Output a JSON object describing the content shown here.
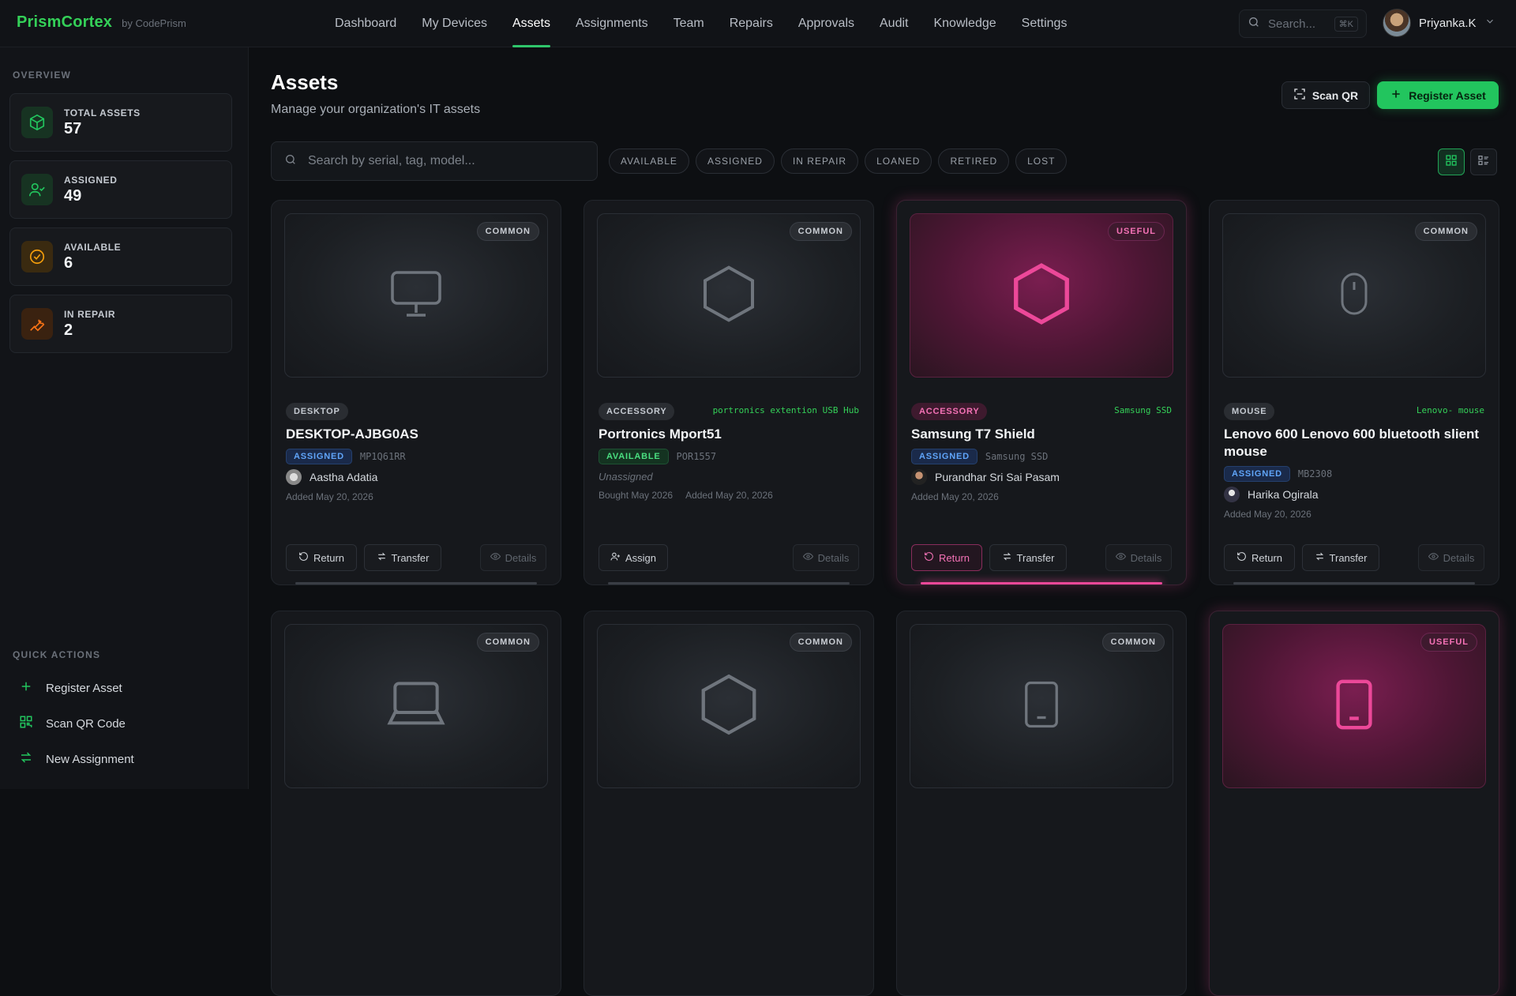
{
  "brand": {
    "name": "PrismCortex",
    "sub": "by CodePrism"
  },
  "nav": [
    "Dashboard",
    "My Devices",
    "Assets",
    "Assignments",
    "Team",
    "Repairs",
    "Approvals",
    "Audit",
    "Knowledge",
    "Settings"
  ],
  "nav_active": "Assets",
  "top_search": {
    "placeholder": "Search...",
    "shortcut": "⌘K"
  },
  "user": {
    "name": "Priyanka.K"
  },
  "sidebar": {
    "overview_label": "OVERVIEW",
    "stats": [
      {
        "label": "TOTAL ASSETS",
        "value": "57",
        "icon": "cube-icon",
        "color": "#22c55e"
      },
      {
        "label": "ASSIGNED",
        "value": "49",
        "icon": "user-check-icon",
        "color": "#22c55e"
      },
      {
        "label": "AVAILABLE",
        "value": "6",
        "icon": "check-circle-icon",
        "color": "#f59e0b"
      },
      {
        "label": "IN REPAIR",
        "value": "2",
        "icon": "wrench-icon",
        "color": "#f97316"
      }
    ],
    "quick_label": "QUICK ACTIONS",
    "quick": [
      {
        "label": "Register Asset",
        "icon": "plus-icon"
      },
      {
        "label": "Scan QR Code",
        "icon": "qr-icon"
      },
      {
        "label": "New Assignment",
        "icon": "swap-icon"
      }
    ]
  },
  "page": {
    "title": "Assets",
    "subtitle": "Manage your organization's IT assets"
  },
  "buttons": {
    "scan": "Scan QR",
    "register": "Register Asset"
  },
  "search": {
    "placeholder": "Search by serial, tag, model..."
  },
  "filters": [
    "AVAILABLE",
    "ASSIGNED",
    "IN REPAIR",
    "LOANED",
    "RETIRED",
    "LOST"
  ],
  "colors": {
    "accent": "#22c55e",
    "pink": "#ec4899",
    "assigned": "#60a5fa"
  },
  "cards": [
    {
      "rarity": "COMMON",
      "category": "DESKTOP",
      "model_note": "",
      "name": "DESKTOP-AJBG0AS",
      "status": "ASSIGNED",
      "serial": "MP1Q61RR",
      "owner": "Aastha Adatia",
      "added": "Added May 20, 2026",
      "actions": [
        "Return",
        "Transfer",
        "Details"
      ],
      "icon": "monitor-icon"
    },
    {
      "rarity": "COMMON",
      "category": "ACCESSORY",
      "model_note": "portronics extention USB Hub",
      "name": "Portronics Mport51",
      "status": "AVAILABLE",
      "serial": "POR1557",
      "owner": "Unassigned",
      "bought": "Bought May 2026",
      "added": "Added May 20, 2026",
      "actions": [
        "Assign",
        "Details"
      ],
      "icon": "hexagon-icon"
    },
    {
      "rarity": "USEFUL",
      "category": "ACCESSORY",
      "model_note": "Samsung SSD",
      "name": "Samsung T7 Shield",
      "status": "ASSIGNED",
      "serial": "Samsung SSD",
      "owner": "Purandhar Sri Sai Pasam",
      "added": "Added May 20, 2026",
      "actions": [
        "Return",
        "Transfer",
        "Details"
      ],
      "icon": "hexagon-icon"
    },
    {
      "rarity": "COMMON",
      "category": "MOUSE",
      "model_note": "Lenovo- mouse",
      "name": "Lenovo 600 Lenovo 600 bluetooth slient mouse",
      "status": "ASSIGNED",
      "serial": "MB2308",
      "owner": "Harika Ogirala",
      "added": "Added May 20, 2026",
      "actions": [
        "Return",
        "Transfer",
        "Details"
      ],
      "icon": "mouse-icon"
    },
    {
      "rarity": "COMMON",
      "icon": "laptop-icon"
    },
    {
      "rarity": "COMMON",
      "icon": "hexagon-icon"
    },
    {
      "rarity": "COMMON",
      "icon": "tablet-icon"
    },
    {
      "rarity": "USEFUL",
      "icon": "tablet-icon"
    }
  ]
}
